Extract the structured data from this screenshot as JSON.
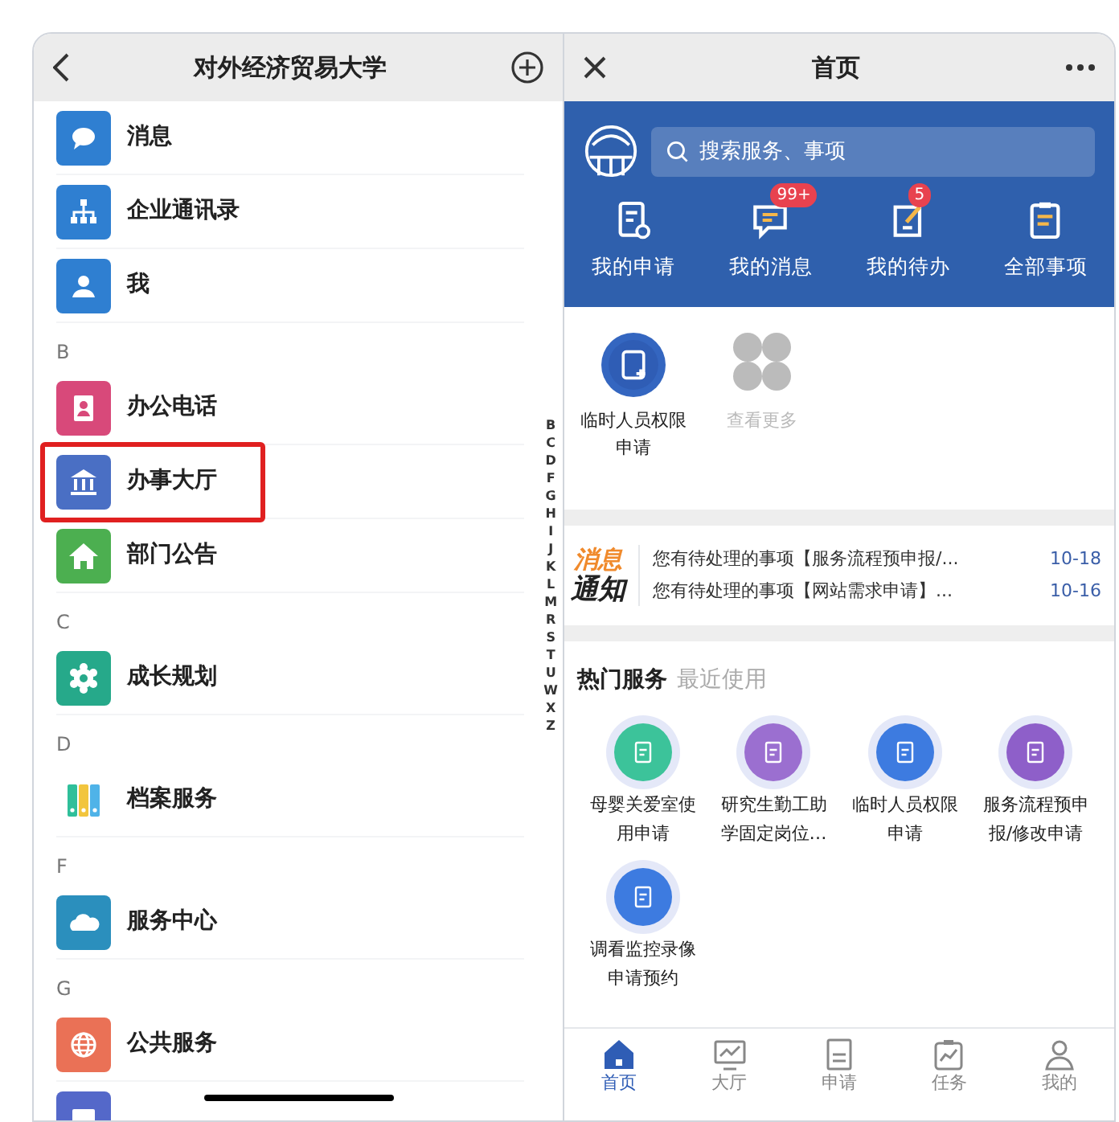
{
  "left_panel": {
    "title": "对外经济贸易大学",
    "items": [
      {
        "kind": "app",
        "label": "消息",
        "color": "#2f7fd1",
        "highlighted": false
      },
      {
        "kind": "app",
        "label": "企业通讯录",
        "color": "#2f7fd1",
        "highlighted": false
      },
      {
        "kind": "app",
        "label": "我",
        "color": "#2f7fd1",
        "highlighted": false
      },
      {
        "kind": "section",
        "label": "B"
      },
      {
        "kind": "app",
        "label": "办公电话",
        "color": "#d8497a",
        "highlighted": false
      },
      {
        "kind": "app",
        "label": "办事大厅",
        "color": "#4a6fc4",
        "highlighted": true
      },
      {
        "kind": "app",
        "label": "部门公告",
        "color": "#4caf50",
        "highlighted": false
      },
      {
        "kind": "section",
        "label": "C"
      },
      {
        "kind": "app",
        "label": "成长规划",
        "color": "#26a98a",
        "highlighted": false
      },
      {
        "kind": "section",
        "label": "D"
      },
      {
        "kind": "app",
        "label": "档案服务",
        "color": "#ffffff",
        "highlighted": false
      },
      {
        "kind": "section",
        "label": "F"
      },
      {
        "kind": "app",
        "label": "服务中心",
        "color": "#2b8fbd",
        "highlighted": false
      },
      {
        "kind": "section",
        "label": "G"
      },
      {
        "kind": "app",
        "label": "公共服务",
        "color": "#ea7156",
        "highlighted": false
      },
      {
        "kind": "app",
        "color": "#5468c9",
        "highlighted": false
      }
    ],
    "index_letters": [
      "B",
      "C",
      "D",
      "F",
      "G",
      "H",
      "I",
      "J",
      "K",
      "L",
      "M",
      "R",
      "S",
      "T",
      "U",
      "W",
      "X",
      "Z"
    ]
  },
  "right_panel": {
    "title": "首页",
    "search": {
      "placeholder": "搜索服务、事项"
    },
    "quick_actions": [
      {
        "label": "我的申请"
      },
      {
        "label": "我的消息",
        "badge": "99+"
      },
      {
        "label": "我的待办",
        "badge": "5"
      },
      {
        "label": "全部事项"
      }
    ],
    "shortcuts": [
      {
        "kind": "service",
        "label": "临时人员权限申请"
      },
      {
        "kind": "more",
        "label": "查看更多"
      }
    ],
    "notice_logo": [
      "消息",
      "通知"
    ],
    "notices": [
      {
        "text": "您有待处理的事项【服务流程预申报/...",
        "date": "10-18"
      },
      {
        "text": "您有待处理的事项【网站需求申请】...",
        "date": "10-16"
      }
    ],
    "service_tabs": [
      {
        "label": "热门服务",
        "selected": true
      },
      {
        "label": "最近使用",
        "selected": false
      }
    ],
    "services": [
      {
        "label": "母婴关爱室使用申请",
        "color": "#3cc39a"
      },
      {
        "label": "研究生勤工助学固定岗位…",
        "color": "#9b6fd0"
      },
      {
        "label": "临时人员权限申请",
        "color": "#3d7be0"
      },
      {
        "label": "服务流程预申报/修改申请",
        "color": "#8e5fc9"
      },
      {
        "label": "调看监控录像申请预约",
        "color": "#3d7be0"
      }
    ],
    "nav": [
      {
        "label": "首页",
        "selected": true
      },
      {
        "label": "大厅",
        "selected": false
      },
      {
        "label": "申请",
        "selected": false
      },
      {
        "label": "任务",
        "selected": false
      },
      {
        "label": "我的",
        "selected": false
      }
    ]
  }
}
